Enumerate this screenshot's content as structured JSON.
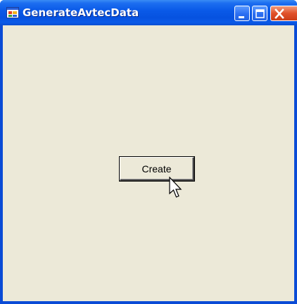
{
  "window": {
    "title": "GenerateAvtecData",
    "icon": "app-icon"
  },
  "titlebar_buttons": {
    "minimize_icon": "minimize-icon",
    "maximize_icon": "maximize-icon",
    "close_icon": "close-icon"
  },
  "main": {
    "create_label": "Create"
  },
  "colors": {
    "titlebar": "#0a5ae8",
    "client_background": "#ece9d8",
    "close_button": "#e0502a"
  }
}
